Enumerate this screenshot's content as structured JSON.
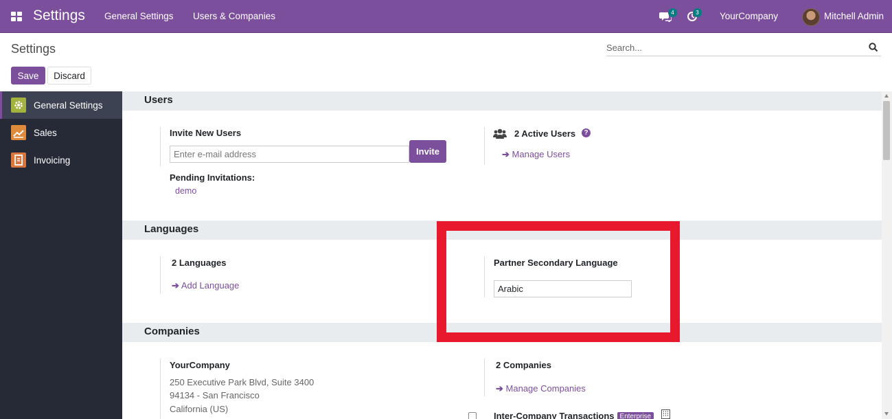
{
  "navbar": {
    "brand": "Settings",
    "menu": [
      "General Settings",
      "Users & Companies"
    ],
    "messages_count": "4",
    "activities_count": "3",
    "company": "YourCompany",
    "user": "Mitchell Admin"
  },
  "control_panel": {
    "title": "Settings",
    "search_placeholder": "Search...",
    "save_label": "Save",
    "discard_label": "Discard"
  },
  "sidebar": {
    "items": [
      {
        "label": "General Settings",
        "icon": "gear-icon",
        "color": "#a4b23f"
      },
      {
        "label": "Sales",
        "icon": "chart-icon",
        "color": "#e08a3c"
      },
      {
        "label": "Invoicing",
        "icon": "invoice-icon",
        "color": "#d9763e"
      }
    ]
  },
  "users": {
    "section": "Users",
    "invite_title": "Invite New Users",
    "email_placeholder": "Enter e-mail address",
    "invite_button": "Invite",
    "pending_title": "Pending Invitations:",
    "pending_user": "demo",
    "active_count": "2",
    "active_label": "Active Users",
    "manage_users": "Manage Users"
  },
  "languages": {
    "section": "Languages",
    "count": "2",
    "count_label": "Languages",
    "add_language": "Add Language",
    "secondary_title": "Partner Secondary Language",
    "secondary_value": "Arabic"
  },
  "companies": {
    "section": "Companies",
    "company_name": "YourCompany",
    "address_line1": "250 Executive Park Blvd, Suite 3400",
    "address_line2": "94134 - San Francisco",
    "address_line3": "California (US)",
    "count": "2",
    "count_label": "Companies",
    "manage_companies": "Manage Companies",
    "inter_company": "Inter-Company Transactions",
    "enterprise_badge": "Enterprise"
  },
  "colors": {
    "brand": "#7c4f9d",
    "highlight": "#e8192c"
  }
}
